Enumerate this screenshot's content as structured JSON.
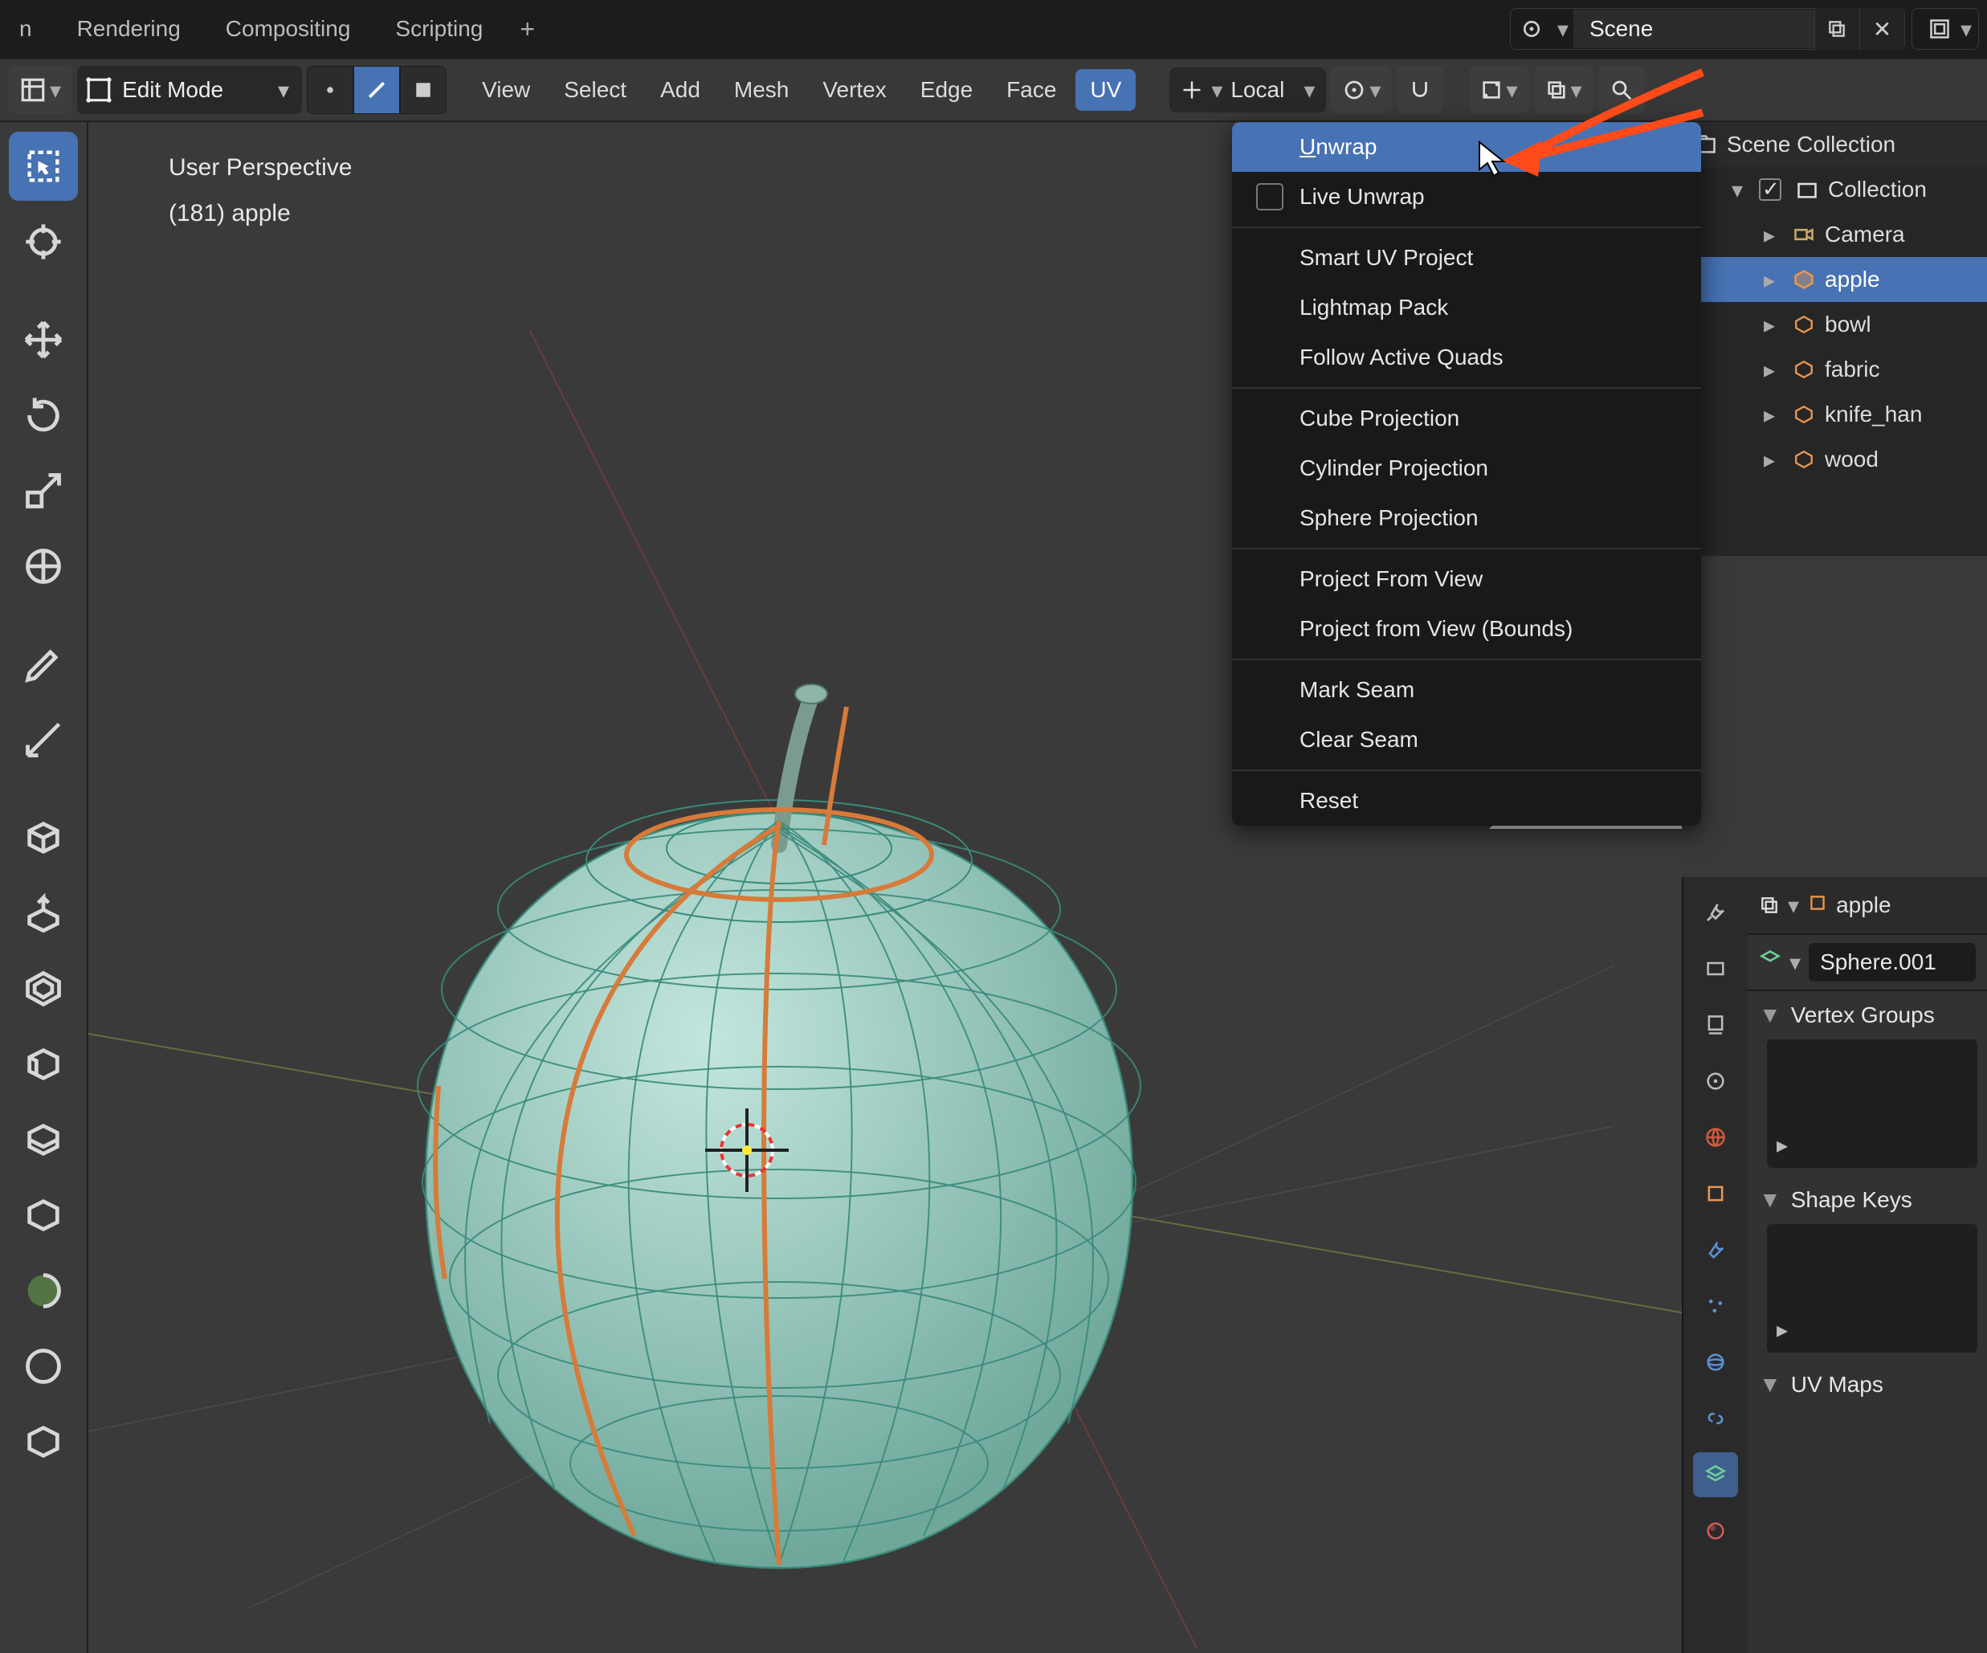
{
  "tabs": {
    "t0": "n",
    "t1": "Rendering",
    "t2": "Compositing",
    "t3": "Scripting"
  },
  "scene": {
    "label": "Scene"
  },
  "header": {
    "mode": "Edit Mode",
    "menus": {
      "view": "View",
      "select": "Select",
      "add": "Add",
      "mesh": "Mesh",
      "vertex": "Vertex",
      "edge": "Edge",
      "face": "Face",
      "uv": "UV"
    },
    "orientation": "Local"
  },
  "viewport": {
    "line1": "User Perspective",
    "line2": "(181) apple"
  },
  "uv_menu": {
    "unwrap": "Unwrap",
    "live_unwrap": "Live Unwrap",
    "smart": "Smart UV Project",
    "lightmap": "Lightmap Pack",
    "follow": "Follow Active Quads",
    "cube": "Cube Projection",
    "cylinder": "Cylinder Projection",
    "sphere": "Sphere Projection",
    "proj_view": "Project From View",
    "proj_bounds": "Project from View (Bounds)",
    "mark_seam": "Mark Seam",
    "clear_seam": "Clear Seam",
    "reset": "Reset"
  },
  "outliner": {
    "root": "Scene Collection",
    "collection": "Collection",
    "items": {
      "camera": "Camera",
      "apple": "apple",
      "bowl": "bowl",
      "fabric": "fabric",
      "knife": "knife_han",
      "wood": "wood"
    }
  },
  "props": {
    "object_name": "apple",
    "data_name": "Sphere.001",
    "vertex_groups": "Vertex Groups",
    "shape_keys": "Shape Keys",
    "uv_maps": "UV Maps"
  }
}
